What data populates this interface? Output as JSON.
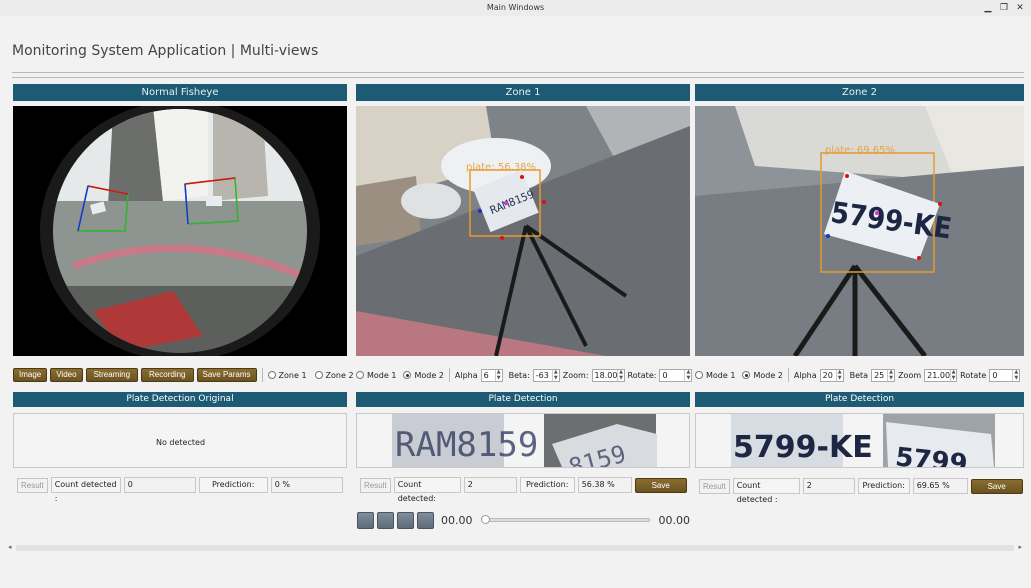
{
  "window": {
    "title": "Main Windows"
  },
  "app": {
    "title": "Monitoring System Application | Multi-views"
  },
  "panels": {
    "fisheye": {
      "header": "Normal Fisheye"
    },
    "zone1": {
      "header": "Zone 1",
      "overlay_text": "plate: 56.38%"
    },
    "zone2": {
      "header": "Zone 2",
      "overlay_text": "plate: 69.65%"
    }
  },
  "fisheye_controls": {
    "buttons": [
      "Image",
      "Video",
      "Streaming",
      "Recording",
      "Save Params"
    ],
    "radios": [
      {
        "label": "Zone 1",
        "checked": false
      },
      {
        "label": "Zone 2",
        "checked": false
      }
    ]
  },
  "zone1_controls": {
    "mode1": "Mode 1",
    "mode2": "Mode 2",
    "mode_selected": "Mode 2",
    "alpha_label": "Alpha",
    "alpha": "6",
    "beta_label": "Beta:",
    "beta": "-63",
    "zoom_label": "Zoom:",
    "zoom": "18.00",
    "rotate_label": "Rotate:",
    "rotate": "0"
  },
  "zone2_controls": {
    "mode1": "Mode 1",
    "mode2": "Mode 2",
    "mode_selected": "Mode 2",
    "alpha_label": "Alpha",
    "alpha": "20",
    "beta_label": "Beta",
    "beta": "25",
    "zoom_label": "Zoom",
    "zoom": "21.00",
    "rotate_label": "Rotate",
    "rotate": "0"
  },
  "detection": {
    "original": {
      "header": "Plate Detection Original",
      "empty_text": "No detected",
      "result_label": "Result",
      "count_label": "Count detected :",
      "count": "0",
      "prediction_label": "Prediction:",
      "prediction": "0 %"
    },
    "zone1": {
      "header": "Plate Detection",
      "plate_text": "RAM8159",
      "result_label": "Result",
      "count_label": "Count detected:",
      "count": "2",
      "prediction_label": "Prediction:",
      "prediction": "56.38 %",
      "save_label": "Save"
    },
    "zone2": {
      "header": "Plate Detection",
      "plate_text": "5799-KE",
      "result_label": "Result",
      "count_label": "Count detected :",
      "count": "2",
      "prediction_label": "Prediction:",
      "prediction": "69.65 %",
      "save_label": "Save"
    }
  },
  "player": {
    "time_current": "00.00",
    "time_total": "00.00",
    "progress": 0
  },
  "colors": {
    "header_bg": "#1d5b75",
    "gold_button": "#7a5f28",
    "bbox": "#e69a2e"
  }
}
